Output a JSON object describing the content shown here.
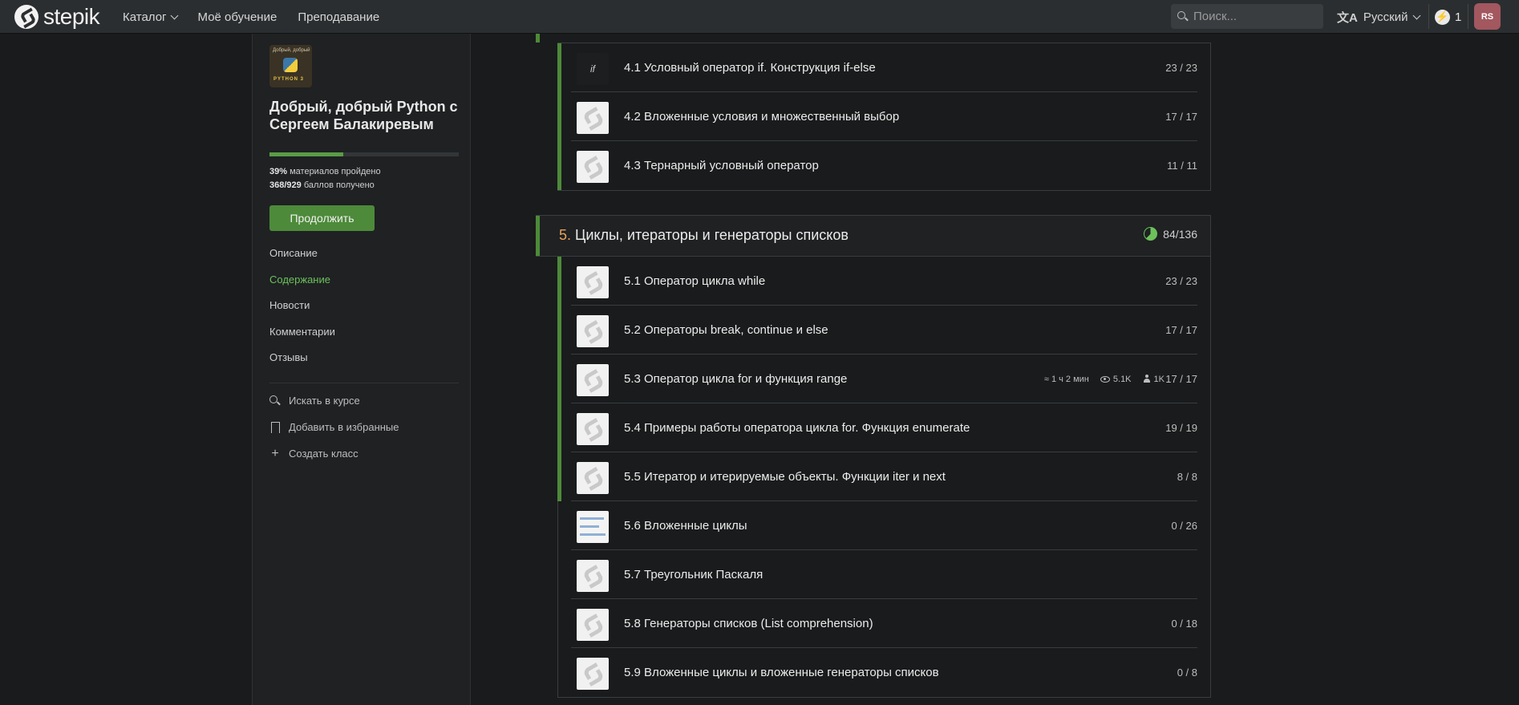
{
  "topbar": {
    "logo_text": "stepik",
    "nav": [
      "Каталог",
      "Моё обучение",
      "Преподавание"
    ],
    "search_placeholder": "Поиск...",
    "language": "Русский",
    "energy_count": "1",
    "avatar_initials": "RS"
  },
  "sidebar": {
    "cover_top": "Добрый, добрый",
    "cover_bottom": "PYTHON 3",
    "course_title": "Добрый, добрый Python с Сергеем Балакиревым",
    "progress_fraction": 0.39,
    "materials_percent": "39%",
    "materials_text": "материалов пройдено",
    "points_value": "368/929",
    "points_text": "баллов получено",
    "continue_label": "Продолжить",
    "links": [
      "Описание",
      "Содержание",
      "Новости",
      "Комментарии",
      "Отзывы"
    ],
    "actions": [
      "Искать в курсе",
      "Добавить в избранные",
      "Создать класс"
    ]
  },
  "module4": {
    "lessons": [
      {
        "title": "4.1 Условный оператор if. Конструкция if-else",
        "score": "23 / 23"
      },
      {
        "title": "4.2 Вложенные условия и множественный выбор",
        "score": "17 / 17"
      },
      {
        "title": "4.3 Тернарный условный оператор",
        "score": "11 / 11"
      }
    ]
  },
  "module5": {
    "number": "5.",
    "title": "Циклы, итераторы и генераторы списков",
    "progress": "84/136",
    "progress_fraction": 0.62,
    "lessons": [
      {
        "title": "5.1 Оператор цикла while",
        "score": "23 / 23"
      },
      {
        "title": "5.2 Операторы break, continue и else",
        "score": "17 / 17"
      },
      {
        "title": "5.3 Оператор цикла for и функция range",
        "score": "17 / 17",
        "time": "≈ 1 ч 2 мин",
        "views": "5.1K",
        "learners": "1K"
      },
      {
        "title": "5.4 Примеры работы оператора цикла for. Функция enumerate",
        "score": "19 / 19"
      },
      {
        "title": "5.5 Итератор и итерируемые объекты. Функции iter и next",
        "score": "8 / 8"
      },
      {
        "title": "5.6 Вложенные циклы",
        "score": "0 / 26"
      },
      {
        "title": "5.7 Треугольник Паскаля",
        "score": ""
      },
      {
        "title": "5.8 Генераторы списков (List comprehension)",
        "score": "0 / 18"
      },
      {
        "title": "5.9 Вложенные циклы и вложенные генераторы списков",
        "score": "0 / 8"
      }
    ]
  }
}
